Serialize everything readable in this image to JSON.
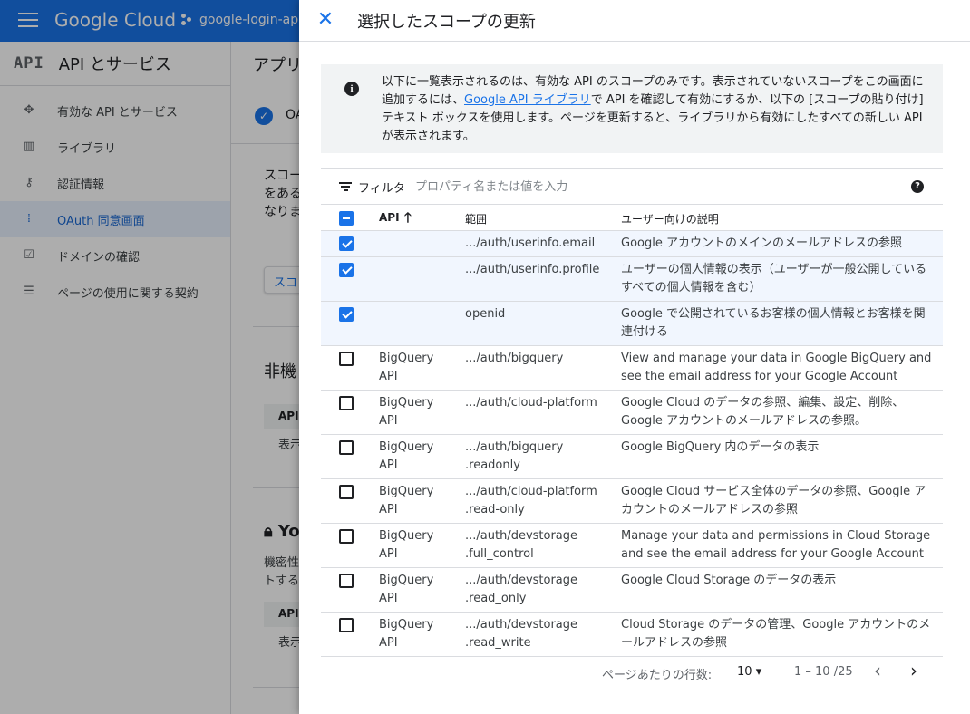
{
  "console": {
    "brand": "Google Cloud",
    "project": "google-login-app",
    "sidebar": {
      "header_icon": "API",
      "title": "API とサービス",
      "items": [
        {
          "label": "有効な API とサービス",
          "icon": "diamond-icon"
        },
        {
          "label": "ライブラリ",
          "icon": "library-icon"
        },
        {
          "label": "認証情報",
          "icon": "key-icon"
        },
        {
          "label": "OAuth 同意画面",
          "icon": "consent-icon",
          "active": true
        },
        {
          "label": "ドメインの確認",
          "icon": "checkbox-icon"
        },
        {
          "label": "ページの使用に関する契約",
          "icon": "settings-list-icon"
        }
      ]
    },
    "main": {
      "title": "アプリ",
      "oauth_label": "OA",
      "para": "スコープをある特なりま",
      "button": "スコ",
      "section1": "非機",
      "th1": "API",
      "cell1": "表示",
      "section2": "Yo",
      "small2": "機密性",
      "small3": "トする",
      "th2": "API",
      "cell2": "表示"
    }
  },
  "panel": {
    "title": "選択したスコープの更新",
    "info": {
      "part1": "以下に一覧表示されるのは、有効な API のスコープのみです。表示されていないスコープをこの画面に追加するには、",
      "link": "Google API ライブラリ",
      "part2": "で API を確認して有効にするか、以下の [スコープの貼り付け] テキスト ボックスを使用します。ページを更新すると、ライブラリから有効にしたすべての新しい API が表示されます。"
    },
    "filter": {
      "label": "フィルタ",
      "placeholder": "プロパティ名または値を入力"
    },
    "columns": {
      "api": "API",
      "scope": "範囲",
      "desc": "ユーザー向けの説明"
    },
    "rows": [
      {
        "checked": true,
        "api": "",
        "scope": ".../auth/userinfo.email",
        "desc": "Google アカウントのメインのメールアドレスの参照"
      },
      {
        "checked": true,
        "api": "",
        "scope": ".../auth/userinfo.profile",
        "desc": "ユーザーの個人情報の表示（ユーザーが一般公開しているすべての個人情報を含む）"
      },
      {
        "checked": true,
        "api": "",
        "scope": "openid",
        "desc": "Google で公開されているお客様の個人情報とお客様を関連付ける"
      },
      {
        "checked": false,
        "api": "BigQuery API",
        "scope": ".../auth/bigquery",
        "desc": "View and manage your data in Google BigQuery and see the email address for your Google Account"
      },
      {
        "checked": false,
        "api": "BigQuery API",
        "scope": ".../auth/cloud-platform",
        "desc": "Google Cloud のデータの参照、編集、設定、削除、Google アカウントのメールアドレスの参照。"
      },
      {
        "checked": false,
        "api": "BigQuery API",
        "scope": ".../auth/bigquery .readonly",
        "desc": "Google BigQuery 内のデータの表示"
      },
      {
        "checked": false,
        "api": "BigQuery API",
        "scope": ".../auth/cloud-platform .read-only",
        "desc": "Google Cloud サービス全体のデータの参照、Google アカウントのメールアドレスの参照"
      },
      {
        "checked": false,
        "api": "BigQuery API",
        "scope": ".../auth/devstorage .full_control",
        "desc": "Manage your data and permissions in Cloud Storage and see the email address for your Google Account"
      },
      {
        "checked": false,
        "api": "BigQuery API",
        "scope": ".../auth/devstorage .read_only",
        "desc": "Google Cloud Storage のデータの表示"
      },
      {
        "checked": false,
        "api": "BigQuery API",
        "scope": ".../auth/devstorage .read_write",
        "desc": "Cloud Storage のデータの管理、Google アカウントのメールアドレスの参照"
      }
    ],
    "pager": {
      "rows_label": "ページあたりの行数:",
      "rows_value": "10",
      "range": "1 – 10 /25"
    }
  }
}
